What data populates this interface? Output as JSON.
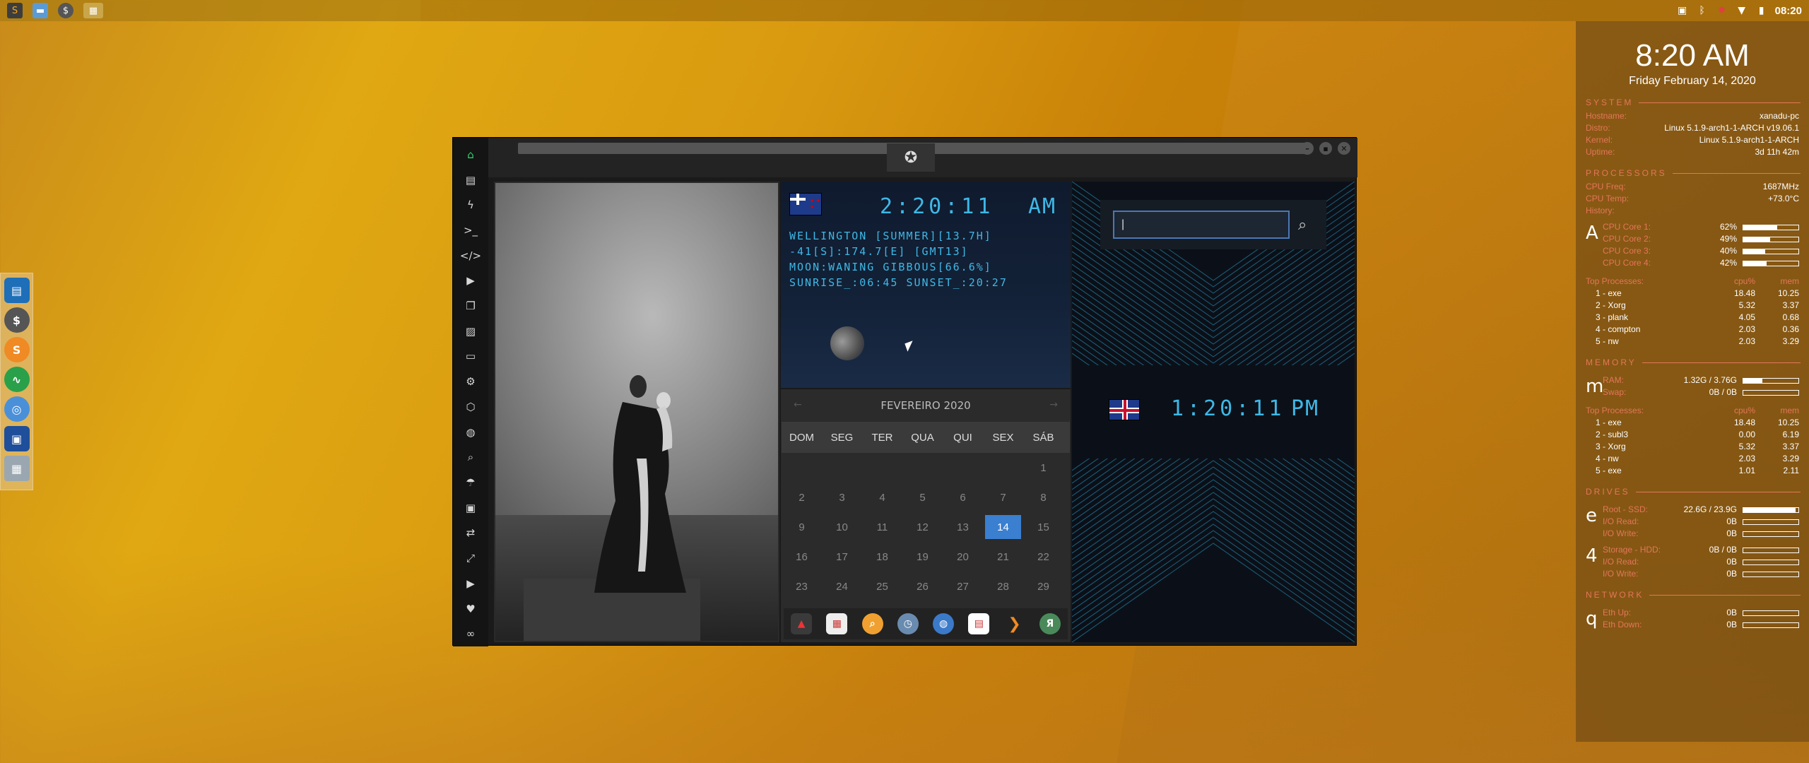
{
  "top_panel": {
    "launchers": [
      "sublime-text",
      "file-manager",
      "terminal",
      "app-grid"
    ],
    "clock": "08:20"
  },
  "left_dock": [
    "app-store",
    "terminal",
    "sublime",
    "system-monitor",
    "chrome",
    "screenshot",
    "network"
  ],
  "window": {
    "sidebar_icons": [
      "home",
      "document",
      "bolt",
      "terminal",
      "code",
      "play",
      "copy",
      "image",
      "news",
      "settings",
      "hexagon",
      "globe",
      "search",
      "umbrella",
      "contact",
      "share",
      "expand",
      "youtube",
      "heart",
      "infinity"
    ],
    "nz_clock": {
      "time": "2:20:11",
      "ampm": "AM",
      "line1": "WELLINGTON [SUMMER][13.7H]",
      "line2": "-41[S]:174.7[E] [GMT13]",
      "line3": "MOON:WANING GIBBOUS[66.6%]",
      "line4": "SUNRISE_:06:45 SUNSET_:20:27"
    },
    "calendar": {
      "month": "FEVEREIRO 2020",
      "prev": "←",
      "next": "→",
      "dows": [
        "DOM",
        "SEG",
        "TER",
        "QUA",
        "QUI",
        "SEX",
        "SÁB"
      ],
      "cells": [
        "",
        "",
        "",
        "",
        "",
        "",
        "1",
        "2",
        "3",
        "4",
        "5",
        "6",
        "7",
        "8",
        "9",
        "10",
        "11",
        "12",
        "13",
        "14",
        "15",
        "16",
        "17",
        "18",
        "19",
        "20",
        "21",
        "22",
        "23",
        "24",
        "25",
        "26",
        "27",
        "28",
        "29"
      ],
      "today": "14"
    },
    "search": {
      "placeholder": "",
      "value": "|"
    },
    "uk_clock": {
      "time": "1:20:11",
      "ampm": "PM"
    }
  },
  "conky": {
    "time": "8:20 AM",
    "date": "Friday February 14, 2020",
    "system_title": "SYSTEM",
    "system": [
      {
        "k": "Hostname:",
        "v": "xanadu-pc"
      },
      {
        "k": "Distro:",
        "v": "Linux 5.1.9-arch1-1-ARCH v19.06.1"
      },
      {
        "k": "Kernel:",
        "v": "Linux 5.1.9-arch1-1-ARCH"
      },
      {
        "k": "Uptime:",
        "v": "3d 11h 42m"
      }
    ],
    "processors_title": "PROCESSORS",
    "cpu_info": [
      {
        "k": "CPU Freq:",
        "v": "1687MHz"
      },
      {
        "k": "CPU Temp:",
        "v": "+73.0°C"
      },
      {
        "k": "History:",
        "v": ""
      }
    ],
    "cpu_letter": "A",
    "cores": [
      {
        "k": "CPU Core 1:",
        "v": "62%",
        "pct": 62
      },
      {
        "k": "CPU Core 2:",
        "v": "49%",
        "pct": 49
      },
      {
        "k": "CPU Core 3:",
        "v": "40%",
        "pct": 40
      },
      {
        "k": "CPU Core 4:",
        "v": "42%",
        "pct": 42
      }
    ],
    "top_proc_title": "Top Processes:",
    "cpu_head": "cpu%",
    "mem_head": "mem",
    "cpu_procs": [
      {
        "n": "1  -  exe",
        "c": "18.48",
        "m": "10.25"
      },
      {
        "n": "2  -  Xorg",
        "c": "5.32",
        "m": "3.37"
      },
      {
        "n": "3  -  plank",
        "c": "4.05",
        "m": "0.68"
      },
      {
        "n": "4  -  compton",
        "c": "2.03",
        "m": "0.36"
      },
      {
        "n": "5  -  nw",
        "c": "2.03",
        "m": "3.29"
      }
    ],
    "memory_title": "MEMORY",
    "mem_letter": "m",
    "mem": [
      {
        "k": "RAM:",
        "v": "1.32G / 3.76G",
        "pct": 35
      },
      {
        "k": "Swap:",
        "v": "0B / 0B",
        "pct": 0
      }
    ],
    "mem_procs": [
      {
        "n": "1  -  exe",
        "c": "18.48",
        "m": "10.25"
      },
      {
        "n": "2  -  subl3",
        "c": "0.00",
        "m": "6.19"
      },
      {
        "n": "3  -  Xorg",
        "c": "5.32",
        "m": "3.37"
      },
      {
        "n": "4  -  nw",
        "c": "2.03",
        "m": "3.29"
      },
      {
        "n": "5  -  exe",
        "c": "1.01",
        "m": "2.11"
      }
    ],
    "drives_title": "DRIVES",
    "drive1_letter": "e",
    "drive1": [
      {
        "k": "Root  -  SSD:",
        "v": "22.6G / 23.9G",
        "pct": 95
      },
      {
        "k": "I/O Read:",
        "v": "0B",
        "pct": 0
      },
      {
        "k": "I/O Write:",
        "v": "0B",
        "pct": 0
      }
    ],
    "drive2_letter": "4",
    "drive2": [
      {
        "k": "Storage  -  HDD:",
        "v": "0B / 0B",
        "pct": 0
      },
      {
        "k": "I/O Read:",
        "v": "0B",
        "pct": 0
      },
      {
        "k": "I/O Write:",
        "v": "0B",
        "pct": 0
      }
    ],
    "network_title": "NETWORK",
    "net_letter": "q",
    "net": [
      {
        "k": "Eth Up:",
        "v": "0B",
        "pct": 0
      },
      {
        "k": "Eth Down:",
        "v": "0B",
        "pct": 0
      }
    ]
  }
}
